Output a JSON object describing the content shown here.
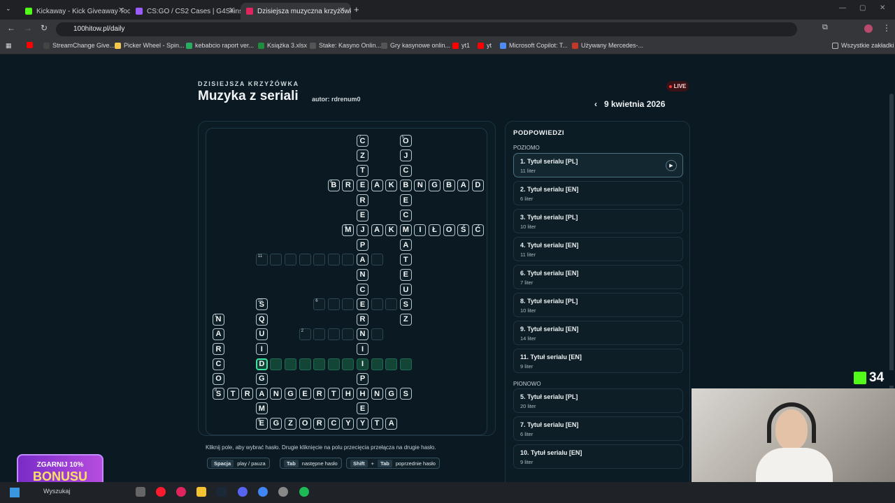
{
  "browser": {
    "tabs": [
      {
        "label": "Kickaway - Kick Giveaway Tool",
        "color": "#53fc18"
      },
      {
        "label": "CS:GO / CS2 Cases | G4Skins Ca",
        "color": "#9b5cff"
      },
      {
        "label": "Dzisiejsza muzyczna krzyżówka",
        "color": "#e0245e"
      }
    ],
    "url": "100hitow.pl/daily",
    "bookmarks": [
      "StreamChange Give...",
      "Picker Wheel - Spin...",
      "kebabcio raport ver...",
      "Książka 3.xlsx",
      "Stake: Kasyno Onlin...",
      "Gry kasynowe onlin...",
      "yt1",
      "yt",
      "Microsoft Copilot: T...",
      "Używany Mercedes-..."
    ],
    "all_bookmarks": "Wszystkie zakładki"
  },
  "header": {
    "kicker": "DZISIEJSZA KRZYŻÓWKA",
    "title": "Muzyka z seriali",
    "author": "autor: rdrenum0",
    "live": "LIVE",
    "date": "9 kwietnia 2026"
  },
  "grid": {
    "cells": [
      {
        "r": 0,
        "c": 10,
        "l": "C",
        "n": "7"
      },
      {
        "r": 1,
        "c": 10,
        "l": "Z"
      },
      {
        "r": 2,
        "c": 10,
        "l": "T"
      },
      {
        "r": 3,
        "c": 10,
        "l": "E"
      },
      {
        "r": 4,
        "c": 10,
        "l": "R"
      },
      {
        "r": 5,
        "c": 10,
        "l": "E"
      },
      {
        "r": 6,
        "c": 10,
        "l": "J"
      },
      {
        "r": 7,
        "c": 10,
        "l": "P"
      },
      {
        "r": 8,
        "c": 10,
        "l": "A"
      },
      {
        "r": 9,
        "c": 10,
        "l": "N"
      },
      {
        "r": 10,
        "c": 10,
        "l": "C"
      },
      {
        "r": 11,
        "c": 10,
        "l": "E"
      },
      {
        "r": 12,
        "c": 10,
        "l": "R"
      },
      {
        "r": 13,
        "c": 10,
        "l": "N"
      },
      {
        "r": 14,
        "c": 10,
        "l": "I"
      },
      {
        "r": 15,
        "c": 10,
        "l": "I",
        "h": true
      },
      {
        "r": 16,
        "c": 10,
        "l": "P"
      },
      {
        "r": 17,
        "c": 10,
        "l": "H"
      },
      {
        "r": 18,
        "c": 10,
        "l": "E"
      },
      {
        "r": 19,
        "c": 10,
        "l": "Y"
      },
      {
        "r": 0,
        "c": 13,
        "l": "O",
        "n": "5"
      },
      {
        "r": 1,
        "c": 13,
        "l": "J"
      },
      {
        "r": 2,
        "c": 13,
        "l": "C"
      },
      {
        "r": 3,
        "c": 13,
        "l": "B"
      },
      {
        "r": 4,
        "c": 13,
        "l": "E"
      },
      {
        "r": 5,
        "c": 13,
        "l": "C"
      },
      {
        "r": 6,
        "c": 13,
        "l": "M"
      },
      {
        "r": 7,
        "c": 13,
        "l": "A"
      },
      {
        "r": 8,
        "c": 13,
        "l": "T"
      },
      {
        "r": 9,
        "c": 13,
        "l": "E"
      },
      {
        "r": 10,
        "c": 13,
        "l": "U"
      },
      {
        "r": 11,
        "c": 13,
        "l": "S"
      },
      {
        "r": 12,
        "c": 13,
        "l": "Z"
      },
      {
        "r": 3,
        "c": 8,
        "l": "B",
        "n": "4"
      },
      {
        "r": 3,
        "c": 9,
        "l": "R"
      },
      {
        "r": 3,
        "c": 11,
        "l": "A"
      },
      {
        "r": 3,
        "c": 12,
        "l": "K"
      },
      {
        "r": 3,
        "c": 14,
        "l": "N"
      },
      {
        "r": 3,
        "c": 15,
        "l": "G"
      },
      {
        "r": 3,
        "c": 16,
        "l": "B"
      },
      {
        "r": 3,
        "c": 17,
        "l": "A"
      },
      {
        "r": 3,
        "c": 18,
        "l": "D"
      },
      {
        "r": 6,
        "c": 9,
        "l": "M",
        "n": "3"
      },
      {
        "r": 6,
        "c": 11,
        "l": "A"
      },
      {
        "r": 6,
        "c": 12,
        "l": "K"
      },
      {
        "r": 6,
        "c": 14,
        "l": "I"
      },
      {
        "r": 6,
        "c": 15,
        "l": "Ł"
      },
      {
        "r": 6,
        "c": 16,
        "l": "O"
      },
      {
        "r": 6,
        "c": 17,
        "l": "Ś"
      },
      {
        "r": 6,
        "c": 18,
        "l": "Ć"
      },
      {
        "r": 8,
        "c": 3,
        "l": "",
        "n": "11"
      },
      {
        "r": 8,
        "c": 4,
        "l": ""
      },
      {
        "r": 8,
        "c": 5,
        "l": ""
      },
      {
        "r": 8,
        "c": 6,
        "l": ""
      },
      {
        "r": 8,
        "c": 7,
        "l": ""
      },
      {
        "r": 8,
        "c": 8,
        "l": ""
      },
      {
        "r": 8,
        "c": 9,
        "l": ""
      },
      {
        "r": 8,
        "c": 11,
        "l": ""
      },
      {
        "r": 11,
        "c": 3,
        "l": "S",
        "n": "10"
      },
      {
        "r": 12,
        "c": 3,
        "l": "Q"
      },
      {
        "r": 13,
        "c": 3,
        "l": "U"
      },
      {
        "r": 14,
        "c": 3,
        "l": "I"
      },
      {
        "r": 15,
        "c": 3,
        "l": "D",
        "sel": true
      },
      {
        "r": 16,
        "c": 3,
        "l": "G"
      },
      {
        "r": 17,
        "c": 3,
        "l": "A"
      },
      {
        "r": 18,
        "c": 3,
        "l": "M"
      },
      {
        "r": 19,
        "c": 3,
        "l": "E"
      },
      {
        "r": 11,
        "c": 7,
        "l": "",
        "n": "6"
      },
      {
        "r": 11,
        "c": 8,
        "l": ""
      },
      {
        "r": 11,
        "c": 9,
        "l": ""
      },
      {
        "r": 11,
        "c": 11,
        "l": ""
      },
      {
        "r": 11,
        "c": 12,
        "l": ""
      },
      {
        "r": 13,
        "c": 6,
        "l": "",
        "n": "2"
      },
      {
        "r": 13,
        "c": 7,
        "l": ""
      },
      {
        "r": 13,
        "c": 8,
        "l": ""
      },
      {
        "r": 13,
        "c": 9,
        "l": ""
      },
      {
        "r": 13,
        "c": 11,
        "l": ""
      },
      {
        "r": 12,
        "c": 0,
        "l": "N",
        "n": "1"
      },
      {
        "r": 13,
        "c": 0,
        "l": "A"
      },
      {
        "r": 14,
        "c": 0,
        "l": "R"
      },
      {
        "r": 15,
        "c": 0,
        "l": "C"
      },
      {
        "r": 16,
        "c": 0,
        "l": "O"
      },
      {
        "r": 17,
        "c": 0,
        "l": "S",
        "n": "8"
      },
      {
        "r": 15,
        "c": 4,
        "l": "",
        "h": true
      },
      {
        "r": 15,
        "c": 5,
        "l": "",
        "h": true
      },
      {
        "r": 15,
        "c": 6,
        "l": "",
        "h": true
      },
      {
        "r": 15,
        "c": 7,
        "l": "",
        "h": true
      },
      {
        "r": 15,
        "c": 8,
        "l": "",
        "h": true
      },
      {
        "r": 15,
        "c": 9,
        "l": "",
        "h": true
      },
      {
        "r": 15,
        "c": 11,
        "l": "",
        "h": true
      },
      {
        "r": 15,
        "c": 12,
        "l": "",
        "h": true
      },
      {
        "r": 15,
        "c": 13,
        "l": "",
        "h": true
      },
      {
        "r": 17,
        "c": 1,
        "l": "T"
      },
      {
        "r": 17,
        "c": 2,
        "l": "R"
      },
      {
        "r": 17,
        "c": 4,
        "l": "N"
      },
      {
        "r": 17,
        "c": 5,
        "l": "G"
      },
      {
        "r": 17,
        "c": 6,
        "l": "E"
      },
      {
        "r": 17,
        "c": 7,
        "l": "R"
      },
      {
        "r": 17,
        "c": 8,
        "l": "T"
      },
      {
        "r": 17,
        "c": 9,
        "l": "H"
      },
      {
        "r": 17,
        "c": 11,
        "l": "N"
      },
      {
        "r": 17,
        "c": 12,
        "l": "G"
      },
      {
        "r": 17,
        "c": 13,
        "l": "S"
      },
      {
        "r": 19,
        "c": 3,
        "l": "E",
        "n": "9"
      },
      {
        "r": 19,
        "c": 4,
        "l": "G"
      },
      {
        "r": 19,
        "c": 5,
        "l": "Z"
      },
      {
        "r": 19,
        "c": 6,
        "l": "O"
      },
      {
        "r": 19,
        "c": 7,
        "l": "R"
      },
      {
        "r": 19,
        "c": 8,
        "l": "C"
      },
      {
        "r": 19,
        "c": 9,
        "l": "Y"
      },
      {
        "r": 19,
        "c": 11,
        "l": "T"
      },
      {
        "r": 19,
        "c": 12,
        "l": "A"
      }
    ]
  },
  "instructions": "Kliknij pole, aby wybrać hasło. Drugie kliknięcie na polu przecięcia przełącza na drugie hasło.",
  "shortcuts": [
    {
      "key": "Spacja",
      "label": "play / pauza"
    },
    {
      "key": "Tab",
      "label": "następne hasło"
    },
    {
      "key": "Shift",
      "key2": "Tab",
      "label": "poprzednie hasło"
    }
  ],
  "clues": {
    "heading": "PODPOWIEDZI",
    "across_label": "POZIOMO",
    "down_label": "PIONOWO",
    "across": [
      {
        "title": "1. Tytuł serialu [PL]",
        "len": "11 liter"
      },
      {
        "title": "2. Tytuł serialu [EN]",
        "len": "6 liter"
      },
      {
        "title": "3. Tytuł serialu [PL]",
        "len": "10 liter"
      },
      {
        "title": "4. Tytuł serialu [EN]",
        "len": "11 liter"
      },
      {
        "title": "6. Tytuł serialu [EN]",
        "len": "7 liter"
      },
      {
        "title": "8. Tytuł serialu [PL]",
        "len": "10 liter"
      },
      {
        "title": "9. Tytuł serialu [EN]",
        "len": "14 liter"
      },
      {
        "title": "11. Tytuł serialu [EN]",
        "len": "9 liter"
      }
    ],
    "down": [
      {
        "title": "5. Tytuł serialu [PL]",
        "len": "20 liter"
      },
      {
        "title": "7. Tytuł serialu [EN]",
        "len": "6 liter"
      },
      {
        "title": "10. Tytuł serialu [EN]",
        "len": "9 liter"
      }
    ]
  },
  "overlay": {
    "kick_count": "34",
    "promo_line1": "ZGARNIJ 10%",
    "promo_line2": "BONUSU",
    "search": "Wyszukaj"
  }
}
